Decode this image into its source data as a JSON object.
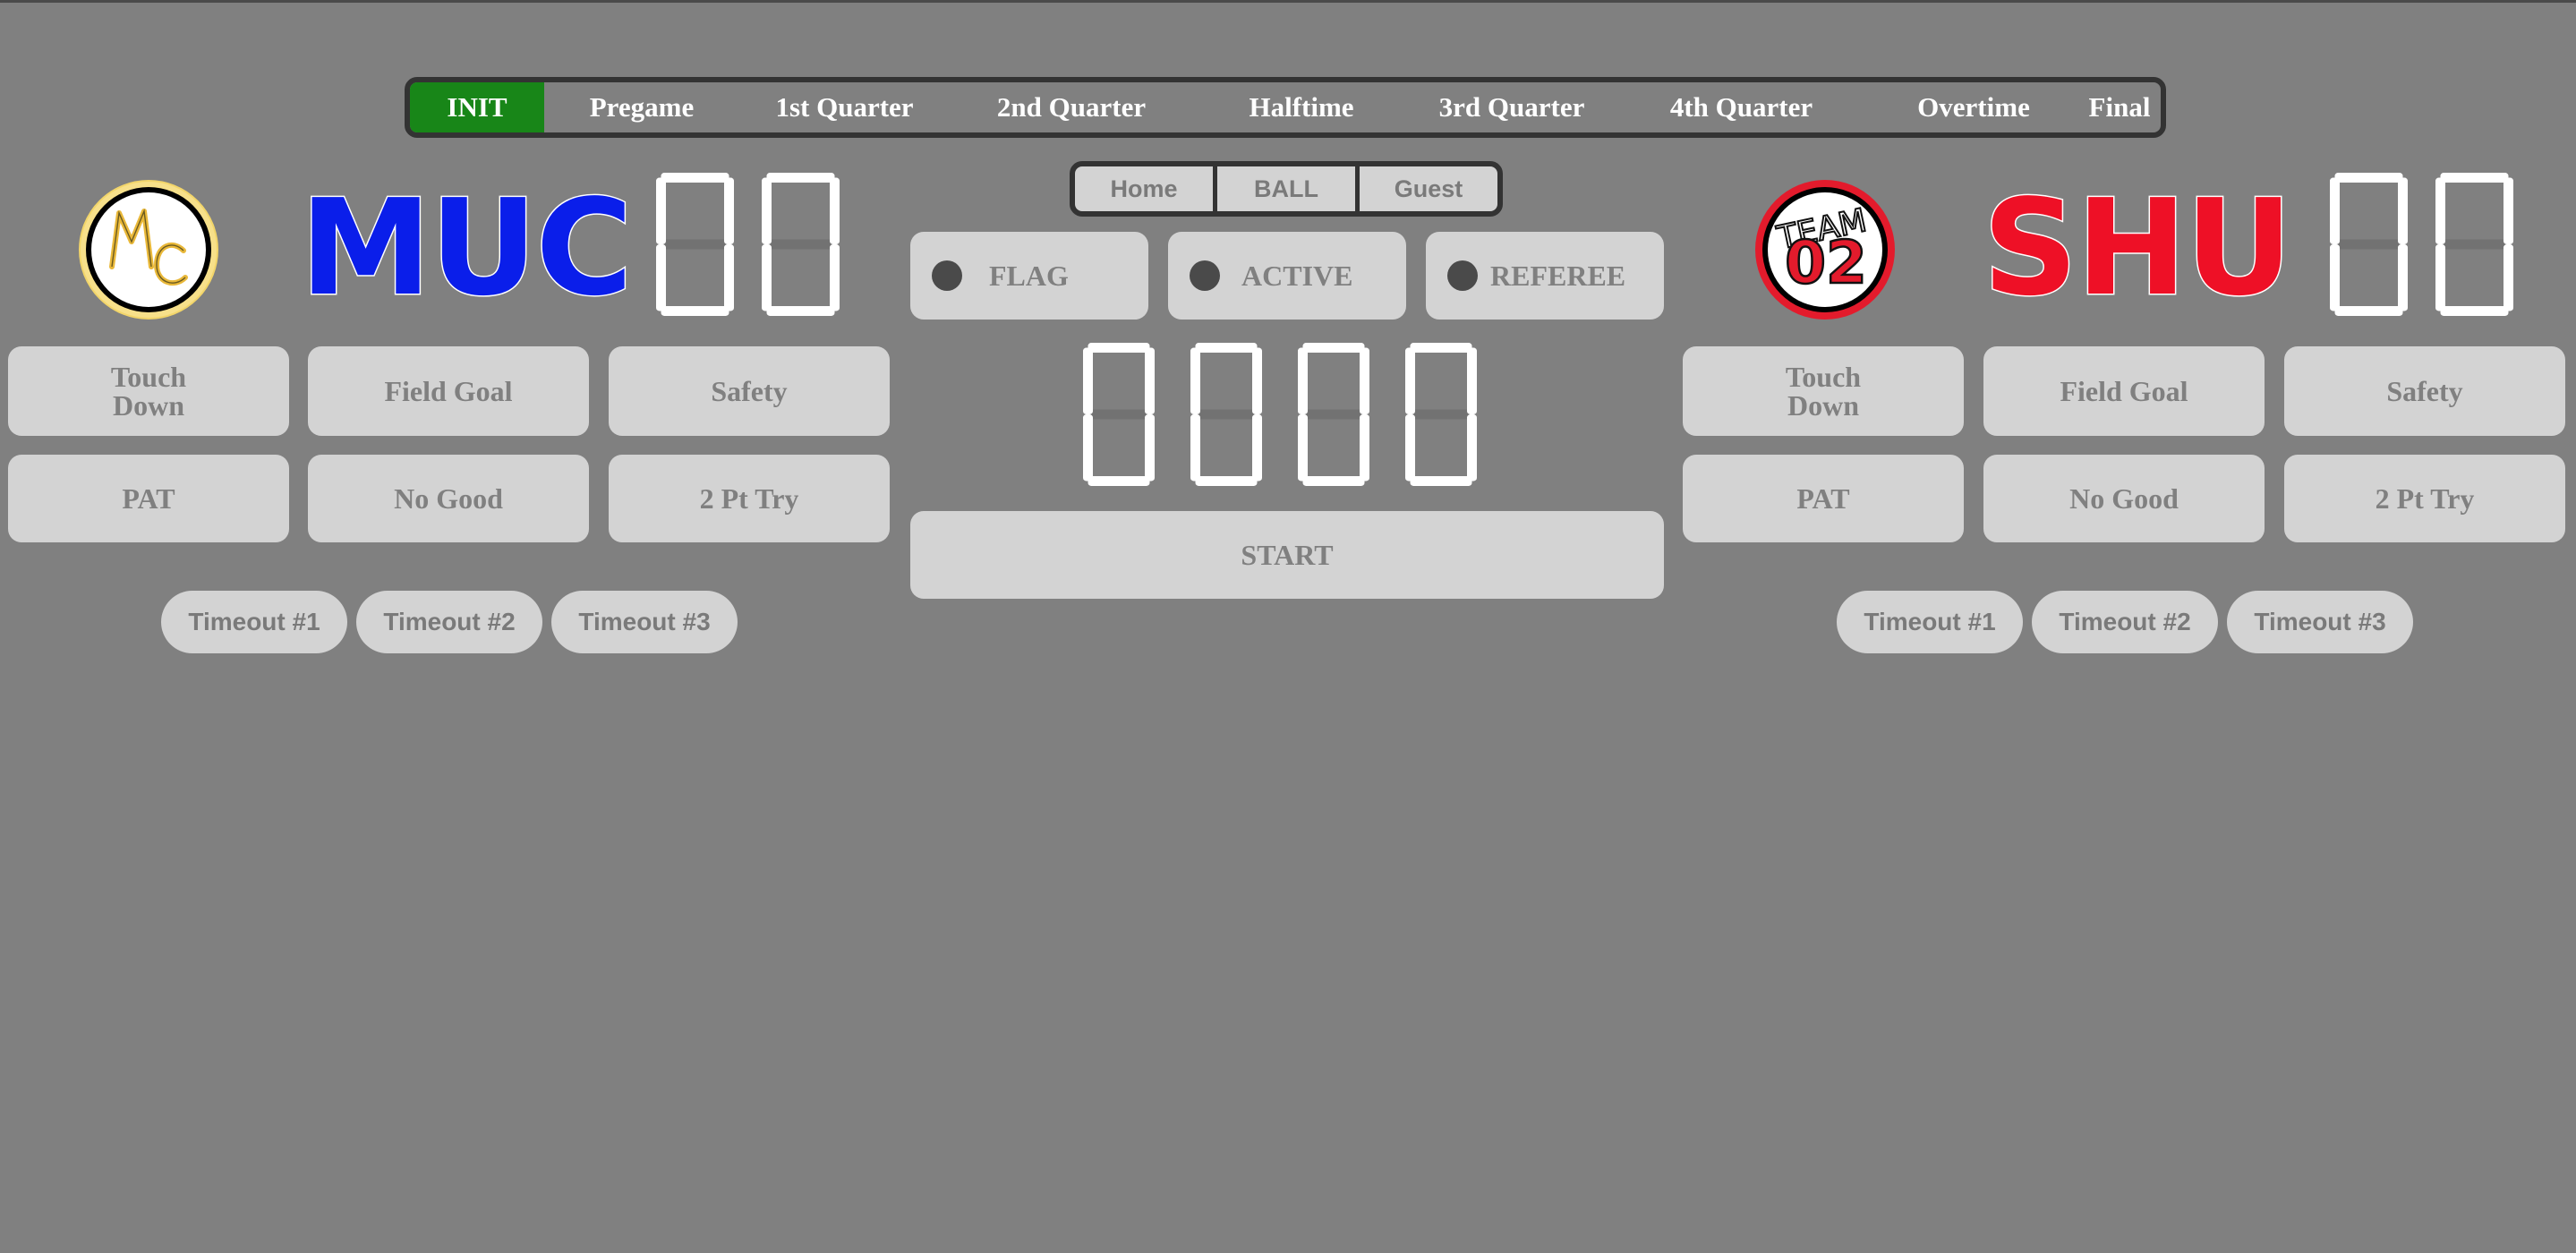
{
  "phases": {
    "items": [
      "INIT",
      "Pregame",
      "1st Quarter",
      "2nd Quarter",
      "Halftime",
      "3rd Quarter",
      "4th Quarter",
      "Overtime",
      "Final"
    ],
    "active": "INIT"
  },
  "possession": {
    "home_label": "Home",
    "ball_label": "BALL",
    "guest_label": "Guest"
  },
  "indicators": {
    "flag_label": "FLAG",
    "active_label": "ACTIVE",
    "referee_label": "REFEREE"
  },
  "clock": {
    "display": "0000",
    "start_label": "START"
  },
  "home": {
    "name": "MUC",
    "score": "00",
    "logo_text": "MC",
    "buttons": {
      "touchdown": "Touch\nDown",
      "field_goal": "Field Goal",
      "safety": "Safety",
      "pat": "PAT",
      "no_good": "No Good",
      "two_pt": "2 Pt Try"
    },
    "timeouts": [
      "Timeout #1",
      "Timeout #2",
      "Timeout #3"
    ]
  },
  "guest": {
    "name": "SHU",
    "score": "00",
    "logo_text_top": "TEAM",
    "logo_text_bottom": "02",
    "buttons": {
      "touchdown": "Touch\nDown",
      "field_goal": "Field Goal",
      "safety": "Safety",
      "pat": "PAT",
      "no_good": "No Good",
      "two_pt": "2 Pt Try"
    },
    "timeouts": [
      "Timeout #1",
      "Timeout #2",
      "Timeout #3"
    ]
  },
  "colors": {
    "background": "#808080",
    "button": "#d3d3d3",
    "button_text": "#808080",
    "active_phase": "#188618",
    "home_accent": "#0a1eea",
    "guest_accent": "#ee1026",
    "led_off": "#4a4a4a"
  },
  "icons": {
    "home_logo": "mc-circle-logo",
    "guest_logo": "team-02-circle-logo",
    "indicator": "led-dot"
  }
}
